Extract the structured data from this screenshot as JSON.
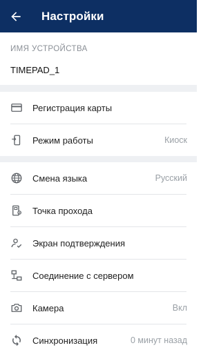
{
  "header": {
    "title": "Настройки"
  },
  "device": {
    "label": "ИМЯ УСТРОЙСТВА",
    "name": "TIMEPAD_1"
  },
  "section1": [
    {
      "icon": "credit-card-icon",
      "label": "Регистрация карты",
      "value": ""
    },
    {
      "icon": "device-mode-icon",
      "label": "Режим работы",
      "value": "Киоск"
    }
  ],
  "section2": [
    {
      "icon": "globe-icon",
      "label": "Смена языка",
      "value": "Русский"
    },
    {
      "icon": "access-point-icon",
      "label": "Точка прохода",
      "value": ""
    },
    {
      "icon": "user-check-icon",
      "label": "Экран подтверждения",
      "value": ""
    },
    {
      "icon": "network-icon",
      "label": "Соединение с сервером",
      "value": ""
    },
    {
      "icon": "camera-icon",
      "label": "Камера",
      "value": "Вкл"
    },
    {
      "icon": "sync-icon",
      "label": "Синхронизация",
      "value": "0 минут назад"
    }
  ],
  "colors": {
    "appbar": "#0d2f63",
    "section_gap": "#eef0f3",
    "icon": "#5f6368",
    "secondary_text": "#9aa0a6"
  }
}
